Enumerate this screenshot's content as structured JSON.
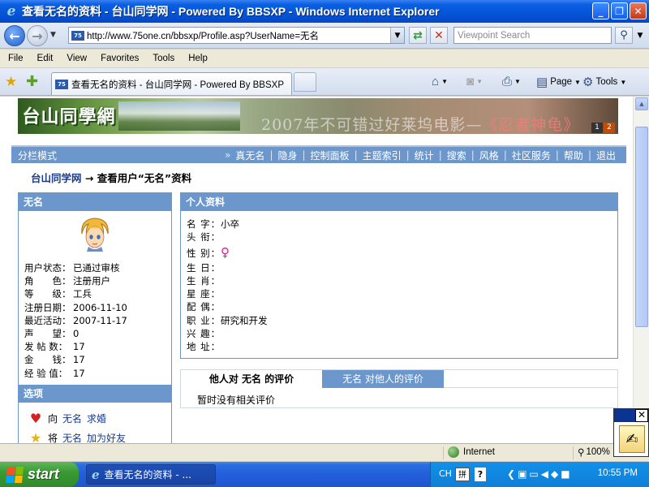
{
  "window": {
    "title": "查看无名的资料 - 台山同学网 - Powered By BBSXP - Windows Internet Explorer"
  },
  "address_bar": {
    "url": "http://www.75one.cn/bbsxp/Profile.asp?UserName=无名",
    "search_placeholder": "Viewpoint Search"
  },
  "menu": [
    "File",
    "Edit",
    "View",
    "Favorites",
    "Tools",
    "Help"
  ],
  "tab": {
    "label": "查看无名的资料 - 台山同学网 - Powered By BBSXP"
  },
  "command_bar": {
    "page_label": "Page",
    "tools_label": "Tools"
  },
  "banner": {
    "logo_text": "台山同學網",
    "ad_text_prefix": "2007年不可错过好莱坞电影—",
    "ad_text_highlight": "《忍者神龟》",
    "pages": [
      "1",
      "2"
    ]
  },
  "navstrip": {
    "mode": "分栏模式",
    "arrow": "»",
    "links": [
      "真无名",
      "隐身",
      "控制面板",
      "主题索引",
      "统计",
      "搜索",
      "风格",
      "社区服务",
      "帮助",
      "退出"
    ]
  },
  "breadcrumb": {
    "home": "台山同学网",
    "arrow": "→",
    "current": "查看用户“无名”资料"
  },
  "user_panel": {
    "title": "无名",
    "stats": [
      {
        "key": "用户状态：",
        "value": "已通过审核"
      },
      {
        "key": "角　　色：",
        "value": "注册用户"
      },
      {
        "key": "等　　级：",
        "value": "工兵"
      },
      {
        "key": "注册日期：",
        "value": "2006-11-10"
      },
      {
        "key": "最近活动：",
        "value": "2007-11-17"
      },
      {
        "key": "声　　望：",
        "value": "0"
      },
      {
        "key": "发 帖 数：",
        "value": "17"
      },
      {
        "key": "金　　钱：",
        "value": "17"
      },
      {
        "key": "经 验 值：",
        "value": "17"
      }
    ],
    "options_title": "选项",
    "options": [
      {
        "prefix": "向",
        "name": "无名",
        "action": "求婚"
      },
      {
        "prefix": "将",
        "name": "无名",
        "action": "加为好友"
      }
    ]
  },
  "profile_panel": {
    "title": "个人资料",
    "fields": [
      {
        "key": "名 字：",
        "value": "小卒"
      },
      {
        "key": "头 衔：",
        "value": ""
      },
      {
        "key": "性 别：",
        "value": "",
        "icon": "female-icon"
      },
      {
        "key": "生 日：",
        "value": ""
      },
      {
        "key": "生 肖：",
        "value": ""
      },
      {
        "key": "星 座：",
        "value": ""
      },
      {
        "key": "配 偶：",
        "value": ""
      },
      {
        "key": "职 业：",
        "value": "研究和开发"
      },
      {
        "key": "兴 趣：",
        "value": ""
      },
      {
        "key": "地 址：",
        "value": ""
      }
    ]
  },
  "rating": {
    "tab_active": "他人对  无名  的评价",
    "tab_other": "无名  对他人的评价",
    "empty_text": "暂时没有相关评价"
  },
  "statusbar": {
    "zone": "Internet",
    "zoom": "100%"
  },
  "taskbar": {
    "start_label": "start",
    "task_label": "查看无名的资料 - ...",
    "lang": "CH",
    "ime": "拼",
    "help": "?",
    "clock": "10:55 PM"
  },
  "colors": {
    "panel_header": "#6b97cc",
    "link": "#1a3a8a",
    "female": "#d5208a"
  }
}
